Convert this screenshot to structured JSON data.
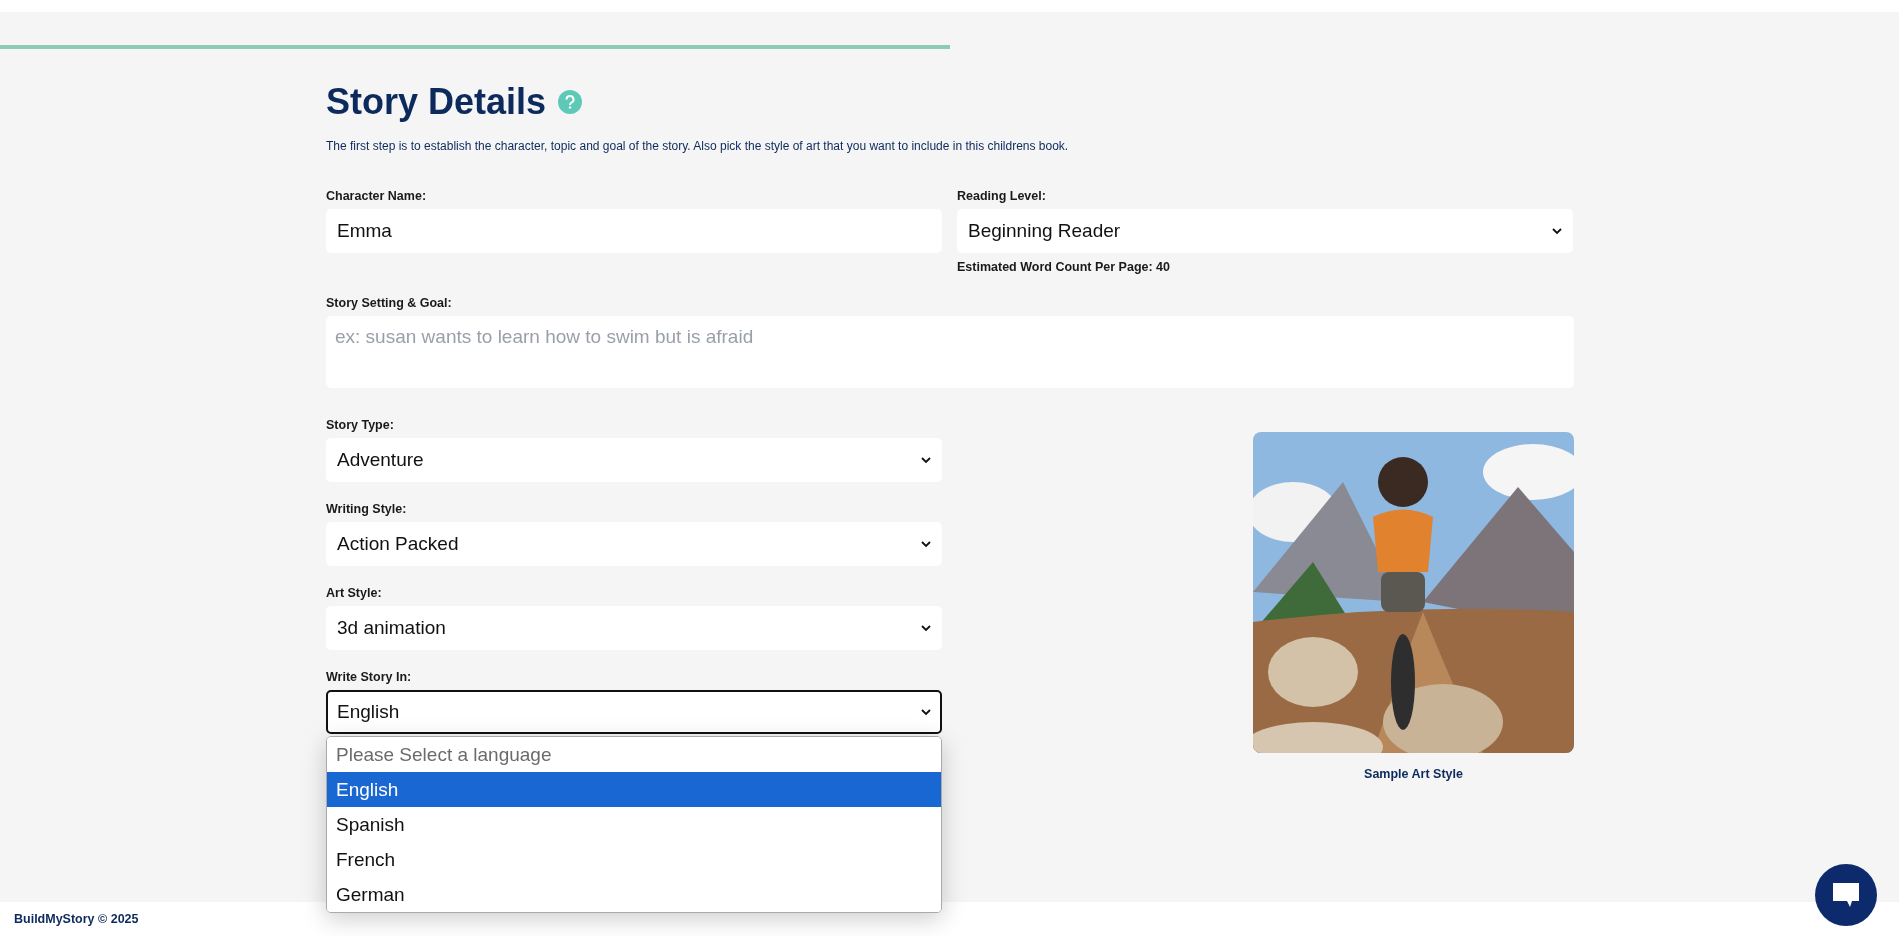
{
  "progress": {
    "level": 0.5
  },
  "header": {
    "title": "Story Details",
    "description": "The first step is to establish the character, topic and goal of the story. Also pick the style of art that you want to include in this childrens book."
  },
  "character_name": {
    "label": "Character Name:",
    "value": "Emma"
  },
  "reading_level": {
    "label": "Reading Level:",
    "value": "Beginning Reader",
    "note": "Estimated Word Count Per Page: 40"
  },
  "story_setting": {
    "label": "Story Setting & Goal:",
    "placeholder": "ex: susan wants to learn how to swim but is afraid"
  },
  "selects": [
    {
      "label": "Story Type:",
      "value": "Adventure",
      "focused": false
    },
    {
      "label": "Writing Style:",
      "value": "Action Packed",
      "focused": false
    },
    {
      "label": "Art Style:",
      "value": "3d animation",
      "focused": false
    },
    {
      "label": "Write Story In:",
      "value": "English",
      "focused": true,
      "open": true,
      "options": [
        {
          "label": "Please Select a language",
          "kind": "placeholder",
          "selected": false
        },
        {
          "label": "English",
          "kind": "option",
          "selected": true
        },
        {
          "label": "Spanish",
          "kind": "option",
          "selected": false
        },
        {
          "label": "French",
          "kind": "option",
          "selected": false
        },
        {
          "label": "German",
          "kind": "option",
          "selected": false
        }
      ]
    }
  ],
  "sample": {
    "kind": "picture",
    "caption": "Sample Art Style"
  },
  "footer": {
    "text": "BuildMyStory © 2025"
  }
}
